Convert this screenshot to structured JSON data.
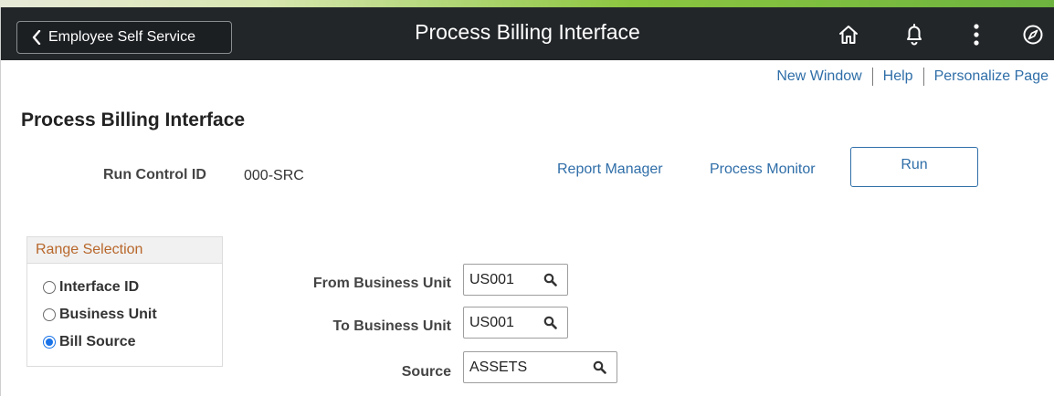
{
  "header": {
    "back_label": "Employee Self Service",
    "title": "Process Billing Interface",
    "icons": [
      "home-icon",
      "bell-icon",
      "more-vertical-icon",
      "compass-icon"
    ]
  },
  "util_links": [
    "New Window",
    "Help",
    "Personalize Page"
  ],
  "page": {
    "heading": "Process Billing Interface",
    "run_control_label": "Run Control ID",
    "run_control_value": "000-SRC",
    "report_manager": "Report Manager",
    "process_monitor": "Process Monitor",
    "run_label": "Run"
  },
  "range": {
    "title": "Range Selection",
    "options": [
      "Interface ID",
      "Business Unit",
      "Bill Source"
    ],
    "selected": "Bill Source"
  },
  "fields": {
    "from_bu": {
      "label": "From Business Unit",
      "value": "US001"
    },
    "to_bu": {
      "label": "To Business Unit",
      "value": "US001"
    },
    "source": {
      "label": "Source",
      "value": "ASSETS"
    }
  },
  "colors": {
    "header_bg": "#222629",
    "link": "#2f6ea8",
    "range_title": "#b8672b",
    "radio_checked": "#1a73e8"
  }
}
